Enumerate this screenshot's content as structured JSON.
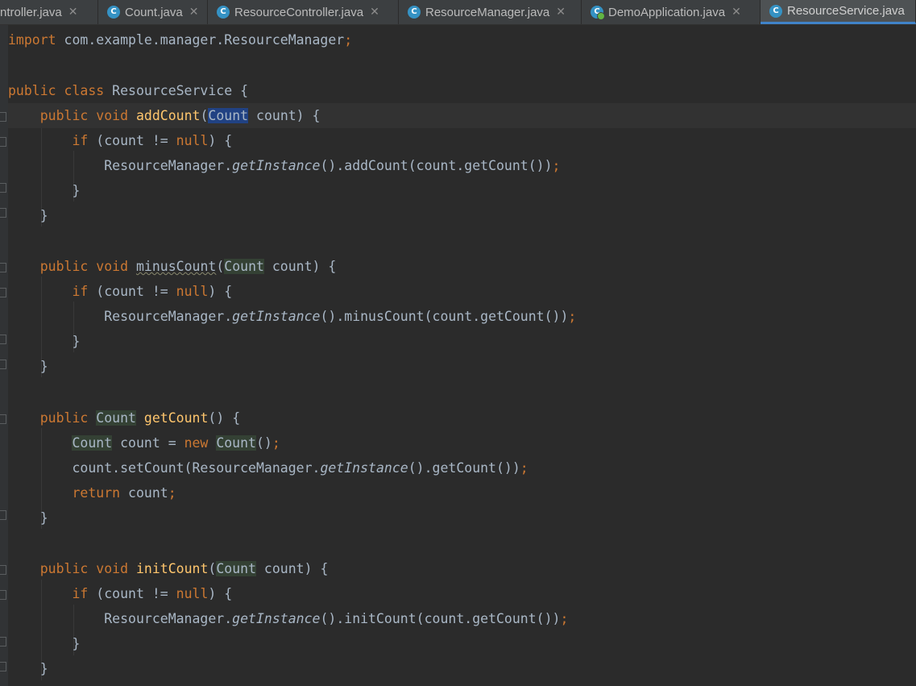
{
  "tabs": [
    {
      "label": "ntroller.java",
      "icon": "class-icon",
      "active": false
    },
    {
      "label": "Count.java",
      "icon": "class-icon",
      "active": false
    },
    {
      "label": "ResourceController.java",
      "icon": "class-icon",
      "active": false
    },
    {
      "label": "ResourceManager.java",
      "icon": "class-icon",
      "active": false
    },
    {
      "label": "DemoApplication.java",
      "icon": "spring-boot-app-icon",
      "active": false
    },
    {
      "label": "ResourceService.java",
      "icon": "class-icon",
      "active": true
    }
  ],
  "icons": {
    "class_glyph": "C",
    "close_glyph": "✕"
  },
  "code": {
    "import_kw": "import",
    "import_path": " com.example.manager.ResourceManager",
    "semicolon": ";",
    "public": "public",
    "class": "class",
    "void": "void",
    "if": "if",
    "null": "null",
    "new": "new",
    "return": "return",
    "class_name": " ResourceService {",
    "type_count": "Count",
    "param_count": " count) {",
    "if_open": " (count != ",
    "if_close": ") {",
    "rm": "ResourceManager.",
    "get_instance": "getInstance",
    "close_brace": "}",
    "add": {
      "name": "addCount",
      "inner": "().addCount(count.getCount())"
    },
    "minus": {
      "name": "minusCount",
      "inner": "().minusCount(count.getCount())"
    },
    "get": {
      "name": "getCount",
      "sig": "() {",
      "decl_mid": " count = ",
      "decl_end": "()",
      "set_pre": "count.setCount(ResourceManager.",
      "set_post": "().getCount())",
      "ret": " count"
    },
    "init": {
      "name": "initCount",
      "inner": "().initCount(count.getCount())"
    }
  },
  "colors": {
    "keyword": "#cc7832",
    "function": "#ffc66d",
    "text": "#a9b7c6",
    "background": "#2b2b2b",
    "accent": "#4083c9"
  }
}
